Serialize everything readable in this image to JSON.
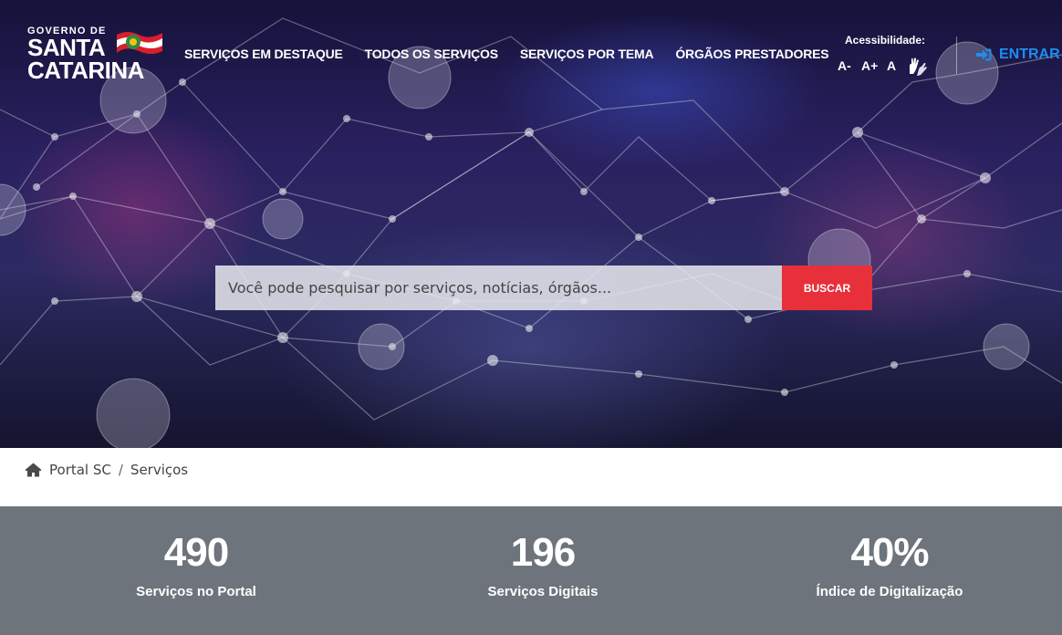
{
  "header": {
    "logo": {
      "small": "GOVERNO DE",
      "line1": "SANTA",
      "line2": "CATARINA"
    },
    "nav": [
      {
        "label": "SERVIÇOS EM DESTAQUE"
      },
      {
        "label": "TODOS OS SERVIÇOS"
      },
      {
        "label": "SERVIÇOS POR TEMA"
      },
      {
        "label": "ÓRGÃOS PRESTADORES"
      }
    ],
    "accessibility": {
      "label": "Acessibilidade:",
      "decrease": "A-",
      "increase": "A+",
      "reset": "A",
      "sign_language_icon": "hands-icon"
    },
    "login": {
      "label": "ENTRAR",
      "icon": "sign-in-icon"
    }
  },
  "search": {
    "placeholder": "Você pode pesquisar por serviços, notícias, órgãos...",
    "button": "BUSCAR"
  },
  "breadcrumb": {
    "home_icon": "home-icon",
    "items": [
      "Portal SC",
      "Serviços"
    ],
    "separator": "/"
  },
  "stats": [
    {
      "value": "490",
      "label": "Serviços no Portal"
    },
    {
      "value": "196",
      "label": "Serviços Digitais"
    },
    {
      "value": "40%",
      "label": "Índice de Digitalização"
    }
  ],
  "colors": {
    "accent_red": "#e8303b",
    "login_blue": "#1c8ef0",
    "stats_bg": "#6d747c"
  }
}
